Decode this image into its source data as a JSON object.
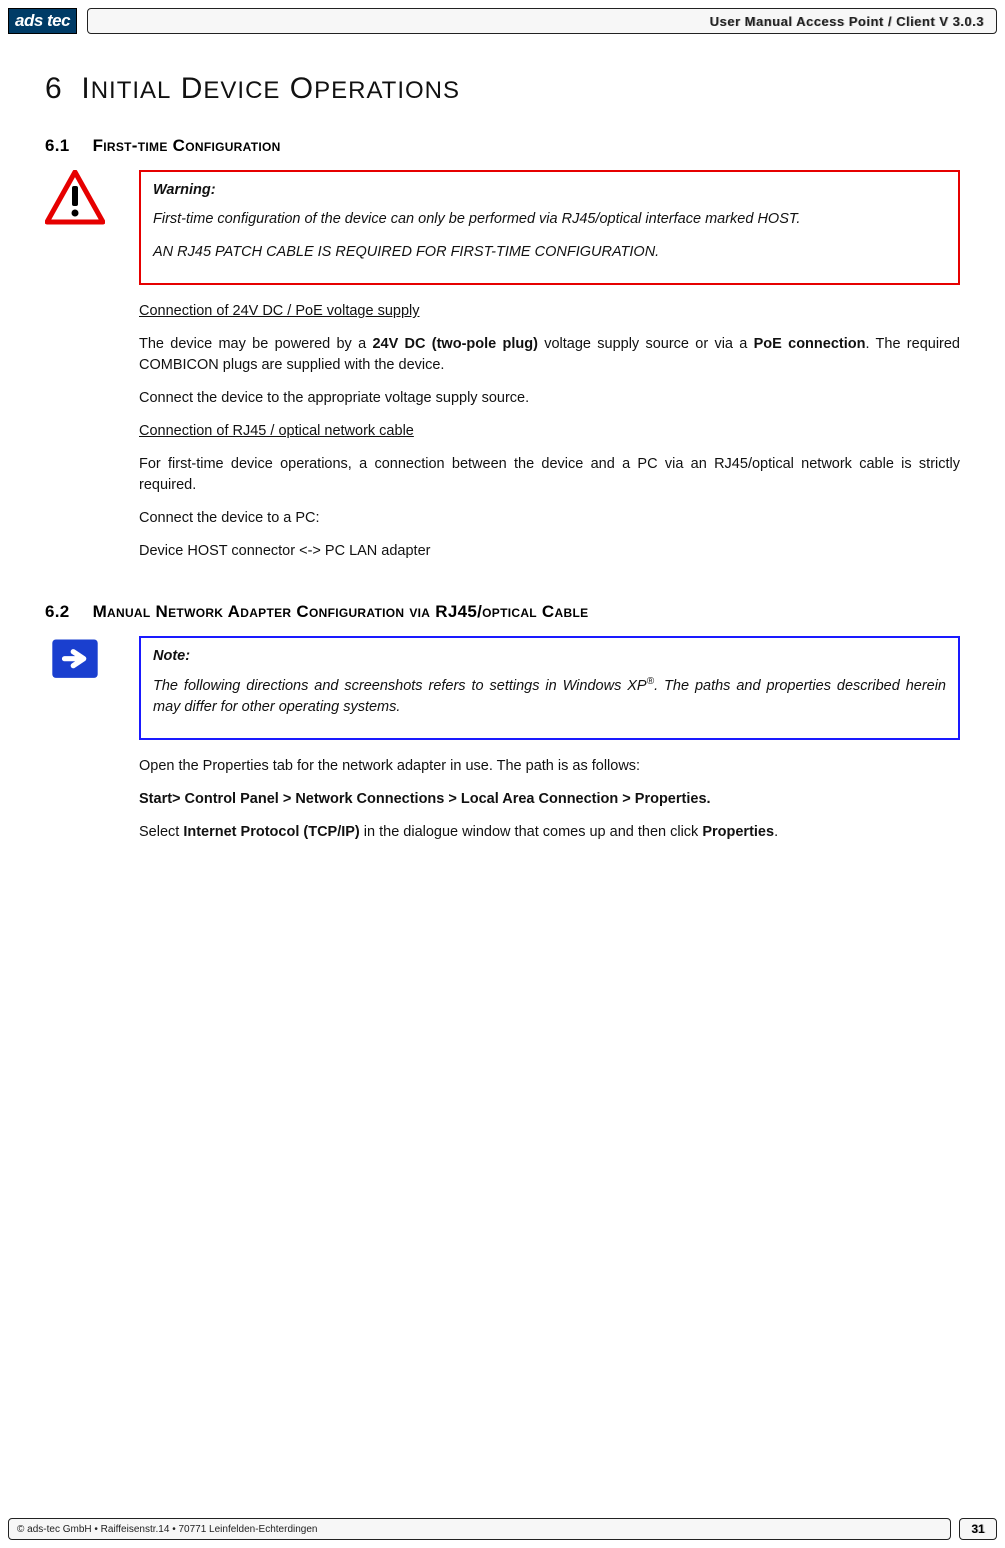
{
  "header": {
    "logo_text": "ads tec",
    "title": "User Manual Access  Point / Client V 3.0.3"
  },
  "chapter": {
    "number": "6",
    "title_html": "I<span style='font-size:24px'>NITIAL</span> D<span style='font-size:24px'>EVICE</span> O<span style='font-size:24px'>PERATIONS</span>"
  },
  "section61": {
    "number": "6.1",
    "title": "First-time Configuration",
    "warning_label": "Warning:",
    "warning_p1": "First-time configuration of the device can only be performed via RJ45/optical interface marked HOST.",
    "warning_p2": "AN RJ45 PATCH CABLE IS REQUIRED FOR FIRST-TIME CONFIGURATION.",
    "sub1_title": "Connection of 24V DC / PoE voltage supply",
    "sub1_p1_a": "The device may be powered by a ",
    "sub1_p1_b": "24V DC (two-pole plug)",
    "sub1_p1_c": " voltage supply source or via a ",
    "sub1_p1_d": "PoE connection",
    "sub1_p1_e": ". The required COMBICON plugs are supplied with the device.",
    "sub1_p2": "Connect the device to the appropriate voltage supply source.",
    "sub2_title": "Connection of RJ45 / optical network cable",
    "sub2_p1": "For first-time device operations, a connection between the device and a PC via an RJ45/optical network cable is strictly required.",
    "sub2_p2": "Connect the device to a PC:",
    "sub2_p3": "Device HOST connector <-> PC LAN adapter"
  },
  "section62": {
    "number": "6.2",
    "title": "Manual Network Adapter Configuration via RJ45/optical Cable",
    "note_label": "Note:",
    "note_p1_a": "The following directions and screenshots refers to settings in Windows XP",
    "note_p1_sup": "®",
    "note_p1_b": ". The paths and properties described herein may differ for other operating systems.",
    "body_p1": "Open the Properties tab for the network adapter in use. The path is as follows:",
    "body_p2": "Start> Control Panel > Network Connections > Local Area Connection > Properties.",
    "body_p3_a": "Select ",
    "body_p3_b": "Internet Protocol (TCP/IP)",
    "body_p3_c": " in the dialogue window that comes up and then click ",
    "body_p3_d": "Properties",
    "body_p3_e": "."
  },
  "footer": {
    "copyright": "© ads-tec GmbH • Raiffeisenstr.14 • 70771 Leinfelden-Echterdingen",
    "page": "31"
  }
}
